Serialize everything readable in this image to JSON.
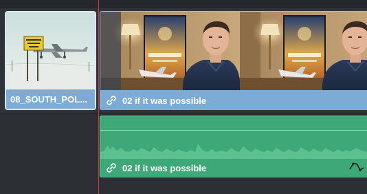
{
  "timeline": {
    "video_clips": [
      {
        "name": "08_SOUTH_POL...",
        "thumbnail": "aircraft-on-snow-with-south-pole-sign",
        "selected": true
      },
      {
        "name": "02 if it was possible",
        "thumbnail": "man-interview-in-hotel-room-with-movie-poster",
        "linked": true
      }
    ],
    "audio_clip": {
      "name": "02 if it was possible",
      "linked": true
    },
    "colors": {
      "video_clip": "#7cabd6",
      "audio_clip": "#3fa878",
      "playhead": "#e0323a"
    }
  }
}
